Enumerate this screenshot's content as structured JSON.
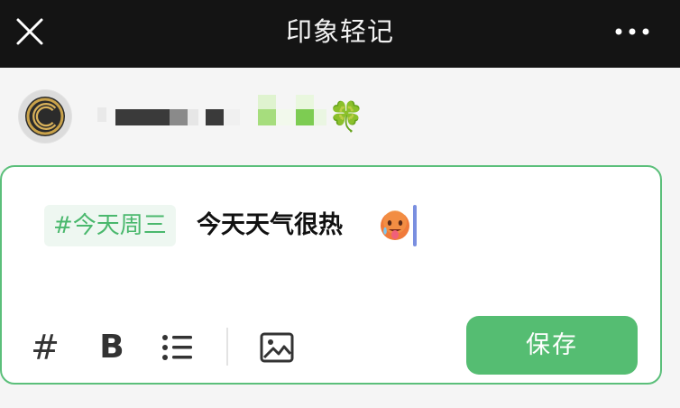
{
  "header": {
    "title": "印象轻记",
    "close_icon": "close-icon",
    "more_icon": "more-icon"
  },
  "profile": {
    "avatar_icon": "avatar-logo-icon",
    "nickname_emoji": "🍀"
  },
  "editor": {
    "tag": "#今天周三",
    "text": "今天天气很热",
    "emoji": "🥵"
  },
  "toolbar": {
    "hashtag_label": "#",
    "bold_label": "B",
    "list_icon": "bullet-list-icon",
    "image_icon": "image-icon",
    "save_label": "保存"
  },
  "colors": {
    "header_bg": "#141414",
    "accent_green": "#55bd72",
    "tag_text": "#4ab86d",
    "tag_bg": "#eef7f1",
    "caret": "#7a8fe0"
  }
}
